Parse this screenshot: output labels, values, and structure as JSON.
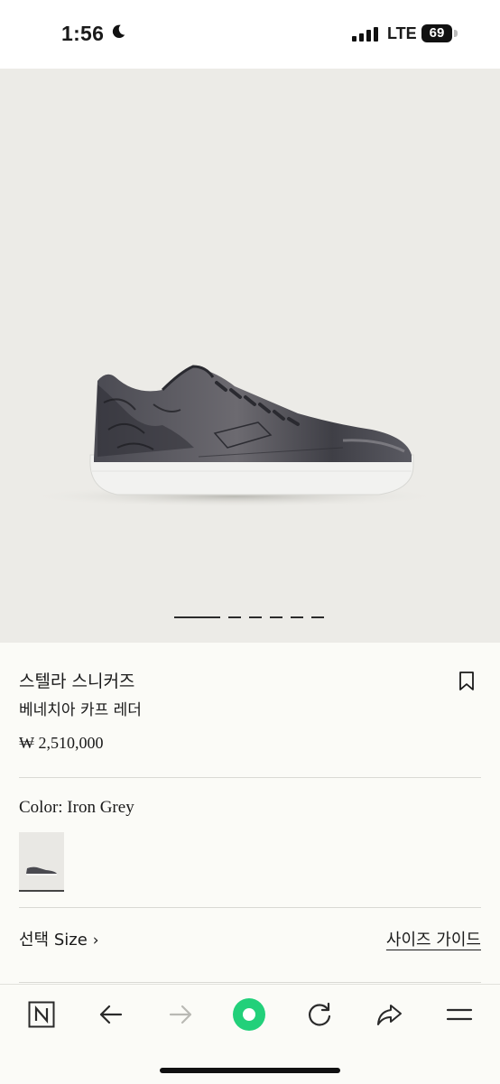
{
  "status_bar": {
    "time": "1:56",
    "network": "LTE",
    "battery": "69"
  },
  "gallery": {
    "image_count": 6,
    "active_index": 0
  },
  "product": {
    "name": "스텔라 스니커즈",
    "material": "베네치아 카프 레더",
    "price": "₩ 2,510,000"
  },
  "color": {
    "label": "Color: Iron Grey"
  },
  "size": {
    "select_label": "선택 Size",
    "guide_label": "사이즈 가이드"
  },
  "toolbar": {
    "icons": [
      "n-logo-icon",
      "back-arrow-icon",
      "forward-arrow-icon",
      "green-dot-icon",
      "refresh-icon",
      "share-icon",
      "menu-icon"
    ]
  },
  "colors": {
    "accent_green": "#22d07a",
    "hero_bg": "#ecebe7",
    "page_bg": "#fbfbf7"
  }
}
